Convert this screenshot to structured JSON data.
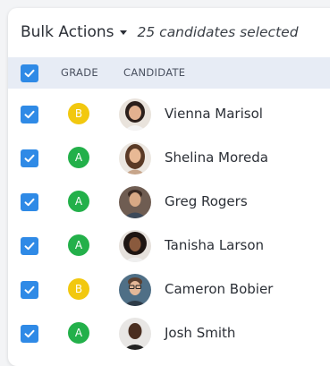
{
  "header": {
    "bulk_actions_label": "Bulk Actions",
    "selected_text": "25 candidates selected"
  },
  "columns": {
    "grade": "GRADE",
    "candidate": "CANDIDATE"
  },
  "rows": [
    {
      "grade": "B",
      "name": "Vienna Marisol",
      "checked": true
    },
    {
      "grade": "A",
      "name": "Shelina Moreda",
      "checked": true
    },
    {
      "grade": "A",
      "name": "Greg Rogers",
      "checked": true
    },
    {
      "grade": "A",
      "name": "Tanisha Larson",
      "checked": true
    },
    {
      "grade": "B",
      "name": "Cameron Bobier",
      "checked": true
    },
    {
      "grade": "A",
      "name": "Josh Smith",
      "checked": true
    }
  ],
  "colors": {
    "checkbox": "#2f8ae6",
    "grade_a": "#23b04a",
    "grade_b": "#f2c80f",
    "header_band": "#e7ecf5"
  }
}
